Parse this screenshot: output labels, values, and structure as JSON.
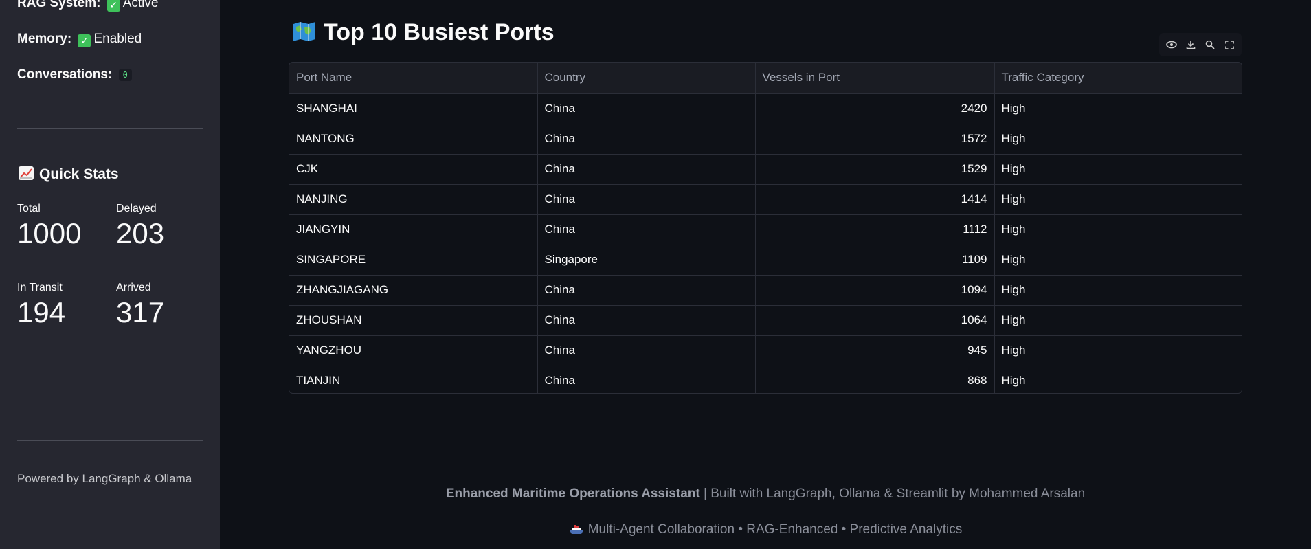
{
  "sidebar": {
    "rag_label": "RAG System:",
    "rag_value": "Active",
    "memory_label": "Memory:",
    "memory_value": "Enabled",
    "conversations_label": "Conversations:",
    "conversations_value": "0",
    "quick_stats_title": "Quick Stats",
    "metrics": [
      {
        "label": "Total",
        "value": "1000"
      },
      {
        "label": "Delayed",
        "value": "203"
      },
      {
        "label": "In Transit",
        "value": "194"
      },
      {
        "label": "Arrived",
        "value": "317"
      }
    ],
    "powered_by": "Powered by LangGraph & Ollama"
  },
  "main": {
    "title": "Top 10 Busiest Ports",
    "toolbar_icons": [
      "eye-icon",
      "download-icon",
      "search-icon",
      "fullscreen-icon"
    ],
    "table": {
      "columns": [
        "Port Name",
        "Country",
        "Vessels in Port",
        "Traffic Category"
      ],
      "rows": [
        [
          "SHANGHAI",
          "China",
          "2420",
          "High"
        ],
        [
          "NANTONG",
          "China",
          "1572",
          "High"
        ],
        [
          "CJK",
          "China",
          "1529",
          "High"
        ],
        [
          "NANJING",
          "China",
          "1414",
          "High"
        ],
        [
          "JIANGYIN",
          "China",
          "1112",
          "High"
        ],
        [
          "SINGAPORE",
          "Singapore",
          "1109",
          "High"
        ],
        [
          "ZHANGJIAGANG",
          "China",
          "1094",
          "High"
        ],
        [
          "ZHOUSHAN",
          "China",
          "1064",
          "High"
        ],
        [
          "YANGZHOU",
          "China",
          "945",
          "High"
        ],
        [
          "TIANJIN",
          "China",
          "868",
          "High"
        ]
      ]
    }
  },
  "footer": {
    "app_name": "Enhanced Maritime Operations Assistant",
    "built_with": " | Built with LangGraph, Ollama & Streamlit by Mohammed Arsalan",
    "tagline": "Multi-Agent Collaboration • RAG-Enhanced • Predictive Analytics"
  },
  "colors": {
    "background": "#0e1117",
    "sidebar": "#262730",
    "check_green": "#3ec15a",
    "code_green": "#5ce488"
  }
}
